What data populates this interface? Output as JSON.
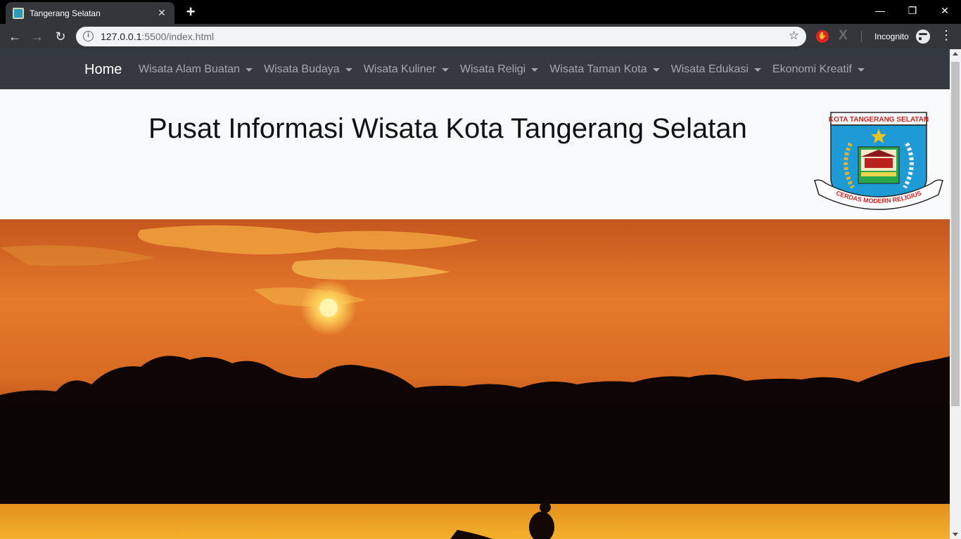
{
  "browser": {
    "tab_title": "Tangerang Selatan",
    "tab_close": "✕",
    "new_tab": "+",
    "url_host": "127.0.0.1",
    "url_path": ":5500/index.html",
    "incognito_label": "Incognito",
    "window_controls": {
      "minimize": "—",
      "restore": "❐",
      "close": "✕"
    },
    "nav": {
      "back": "←",
      "forward": "→",
      "reload": "↻"
    }
  },
  "site": {
    "brand": "Home",
    "menu": [
      "Wisata Alam Buatan",
      "Wisata Budaya",
      "Wisata Kuliner",
      "Wisata Religi",
      "Wisata Taman Kota",
      "Wisata Edukasi",
      "Ekonomi Kreatif"
    ],
    "title": "Pusat Informasi Wisata Kota Tangerang Selatan",
    "logo": {
      "banner_text": "KOTA TANGERANG SELATAN",
      "motto": "CERDAS MODERN RELIGIUS"
    }
  },
  "colors": {
    "navbar": "#343a40",
    "page_bg": "#f8f9fa",
    "logo_blue": "#1e9bd7",
    "logo_red": "#d62020"
  }
}
